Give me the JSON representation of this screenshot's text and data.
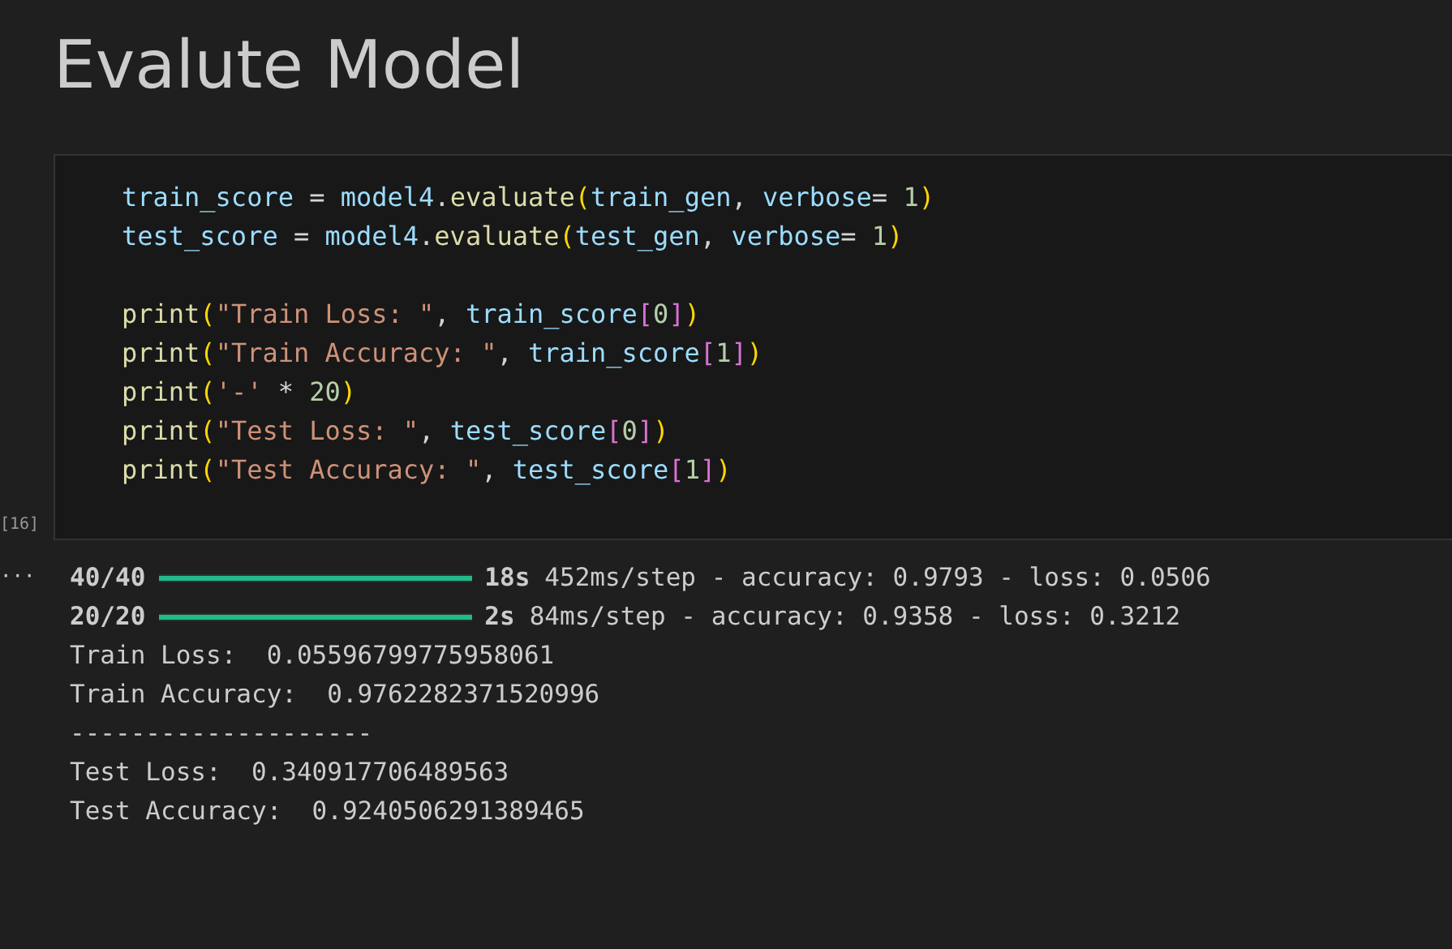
{
  "heading": "Evalute Model",
  "cell": {
    "execution_count": "[16]",
    "code_blocks": [
      [
        [
          {
            "t": "train_score",
            "kind": "var"
          },
          {
            "t": " = ",
            "kind": "op"
          },
          {
            "t": "model4",
            "kind": "var"
          },
          {
            "t": ".",
            "kind": "op"
          },
          {
            "t": "evaluate",
            "kind": "func"
          },
          {
            "t": "(",
            "kind": "b1"
          },
          {
            "t": "train_gen",
            "kind": "var"
          },
          {
            "t": ", ",
            "kind": "op"
          },
          {
            "t": "verbose",
            "kind": "var"
          },
          {
            "t": "= ",
            "kind": "op"
          },
          {
            "t": "1",
            "kind": "num"
          },
          {
            "t": ")",
            "kind": "b1"
          }
        ],
        [
          {
            "t": "test_score",
            "kind": "var"
          },
          {
            "t": " = ",
            "kind": "op"
          },
          {
            "t": "model4",
            "kind": "var"
          },
          {
            "t": ".",
            "kind": "op"
          },
          {
            "t": "evaluate",
            "kind": "func"
          },
          {
            "t": "(",
            "kind": "b1"
          },
          {
            "t": "test_gen",
            "kind": "var"
          },
          {
            "t": ", ",
            "kind": "op"
          },
          {
            "t": "verbose",
            "kind": "var"
          },
          {
            "t": "= ",
            "kind": "op"
          },
          {
            "t": "1",
            "kind": "num"
          },
          {
            "t": ")",
            "kind": "b1"
          }
        ]
      ],
      [
        [
          {
            "t": "print",
            "kind": "func"
          },
          {
            "t": "(",
            "kind": "b1"
          },
          {
            "t": "\"Train Loss: \"",
            "kind": "str"
          },
          {
            "t": ", ",
            "kind": "op"
          },
          {
            "t": "train_score",
            "kind": "var"
          },
          {
            "t": "[",
            "kind": "b2"
          },
          {
            "t": "0",
            "kind": "num"
          },
          {
            "t": "]",
            "kind": "b2"
          },
          {
            "t": ")",
            "kind": "b1"
          }
        ],
        [
          {
            "t": "print",
            "kind": "func"
          },
          {
            "t": "(",
            "kind": "b1"
          },
          {
            "t": "\"Train Accuracy: \"",
            "kind": "str"
          },
          {
            "t": ", ",
            "kind": "op"
          },
          {
            "t": "train_score",
            "kind": "var"
          },
          {
            "t": "[",
            "kind": "b2"
          },
          {
            "t": "1",
            "kind": "num"
          },
          {
            "t": "]",
            "kind": "b2"
          },
          {
            "t": ")",
            "kind": "b1"
          }
        ],
        [
          {
            "t": "print",
            "kind": "func"
          },
          {
            "t": "(",
            "kind": "b1"
          },
          {
            "t": "'-'",
            "kind": "str"
          },
          {
            "t": " * ",
            "kind": "op"
          },
          {
            "t": "20",
            "kind": "num"
          },
          {
            "t": ")",
            "kind": "b1"
          }
        ],
        [
          {
            "t": "print",
            "kind": "func"
          },
          {
            "t": "(",
            "kind": "b1"
          },
          {
            "t": "\"Test Loss: \"",
            "kind": "str"
          },
          {
            "t": ", ",
            "kind": "op"
          },
          {
            "t": "test_score",
            "kind": "var"
          },
          {
            "t": "[",
            "kind": "b2"
          },
          {
            "t": "0",
            "kind": "num"
          },
          {
            "t": "]",
            "kind": "b2"
          },
          {
            "t": ")",
            "kind": "b1"
          }
        ],
        [
          {
            "t": "print",
            "kind": "func"
          },
          {
            "t": "(",
            "kind": "b1"
          },
          {
            "t": "\"Test Accuracy: \"",
            "kind": "str"
          },
          {
            "t": ", ",
            "kind": "op"
          },
          {
            "t": "test_score",
            "kind": "var"
          },
          {
            "t": "[",
            "kind": "b2"
          },
          {
            "t": "1",
            "kind": "num"
          },
          {
            "t": "]",
            "kind": "b2"
          },
          {
            "t": ")",
            "kind": "b1"
          }
        ]
      ]
    ]
  },
  "output": {
    "menu_label": "···",
    "lines": [
      {
        "kind": "progress",
        "count": "40/40",
        "level": 1,
        "time": "18s",
        "rest": "452ms/step - accuracy: 0.9793 - loss: 0.0506"
      },
      {
        "kind": "progress",
        "count": "20/20",
        "level": 1,
        "time": "2s",
        "rest": "84ms/step - accuracy: 0.9358 - loss: 0.3212"
      },
      {
        "kind": "text",
        "text": "Train Loss:  0.05596799775958061"
      },
      {
        "kind": "text",
        "text": "Train Accuracy:  0.9762282371520996"
      },
      {
        "kind": "text",
        "text": "--------------------"
      },
      {
        "kind": "text",
        "text": "Test Loss:  0.340917706489563"
      },
      {
        "kind": "text",
        "text": "Test Accuracy:  0.9240506291389465"
      }
    ]
  }
}
